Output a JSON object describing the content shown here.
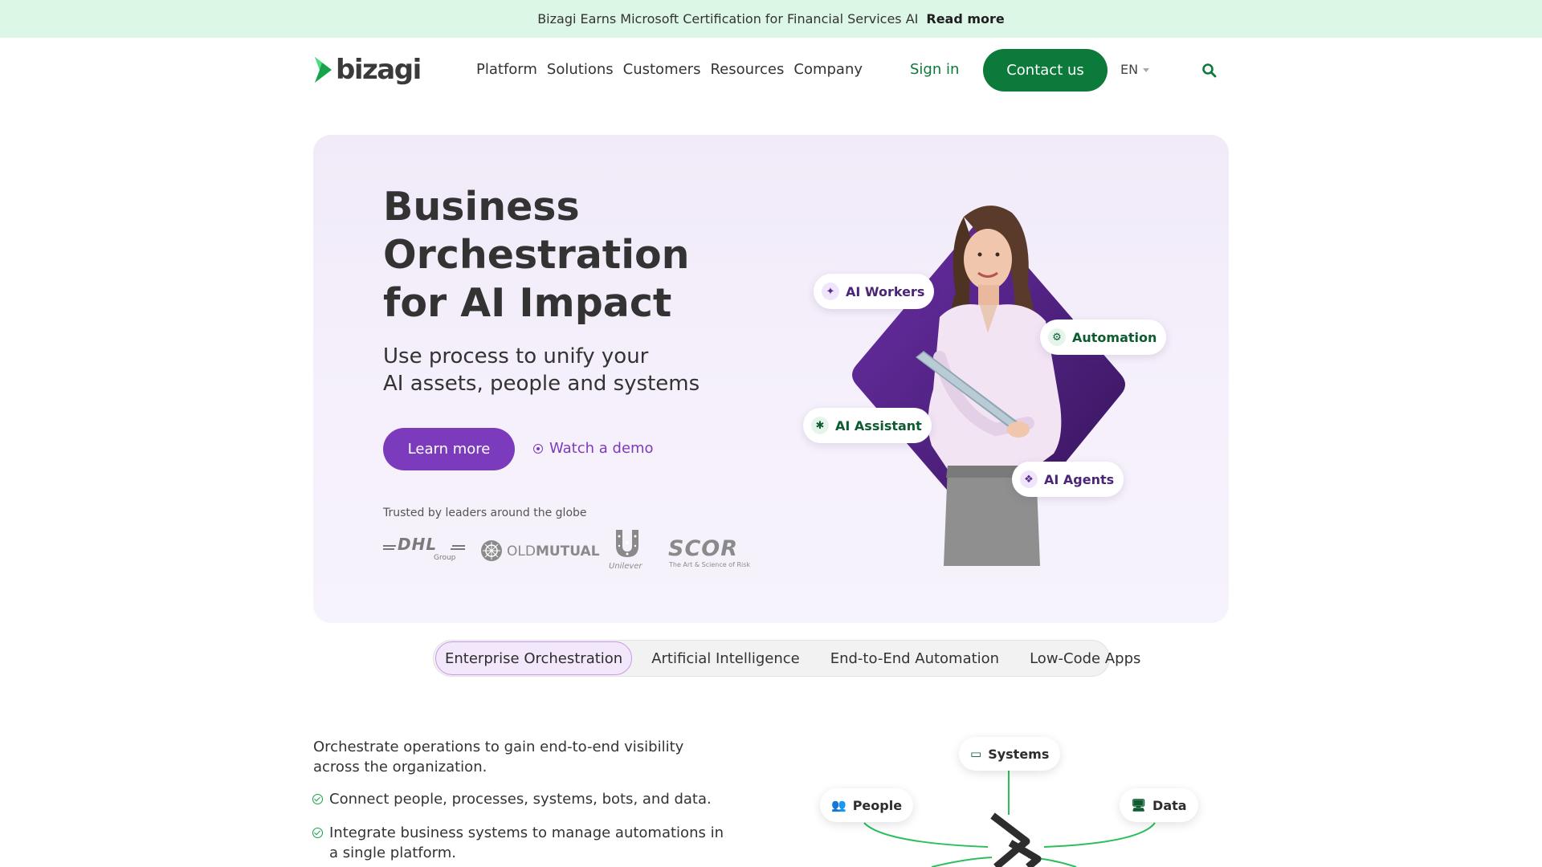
{
  "announcement": {
    "text": "Bizagi Earns Microsoft Certification for Financial Services AI",
    "link": "Read more"
  },
  "header": {
    "logo_text": "bizagi",
    "nav": [
      "Platform",
      "Solutions",
      "Customers",
      "Resources",
      "Company"
    ],
    "sign_in": "Sign in",
    "contact": "Contact us",
    "language": "EN"
  },
  "hero": {
    "title_lines": [
      "Business",
      "Orchestration",
      "for AI Impact"
    ],
    "subtitle_lines": [
      "Use process to unify your",
      "AI assets, people and systems"
    ],
    "primary_cta": "Learn more",
    "secondary_cta": "Watch a demo",
    "trusted_label": "Trusted by leaders around the globe",
    "customer_logos": {
      "dhl": {
        "name": "DHL",
        "sub": "Group"
      },
      "oldmutual": {
        "name_light": "OLD",
        "name_bold": "MUTUAL"
      },
      "unilever": {
        "name": "Unilever"
      },
      "scor": {
        "name": "SCOR",
        "tagline": "The Art & Science of Risk"
      }
    },
    "chips": {
      "ai_workers": "AI Workers",
      "automation": "Automation",
      "ai_assistant": "AI Assistant",
      "ai_agents": "AI Agents"
    }
  },
  "tabs": [
    "Enterprise Orchestration",
    "Artificial Intelligence",
    "End-to-End Automation",
    "Low-Code Apps"
  ],
  "active_tab": "Enterprise Orchestration",
  "content": {
    "description": "Orchestrate operations to gain end-to-end visibility across the organization.",
    "bullets": [
      "Connect people, processes, systems, bots, and data.",
      "Integrate business systems to manage automations in a single platform."
    ]
  },
  "diagram": {
    "systems": "Systems",
    "people": "People",
    "data": "Data"
  },
  "colors": {
    "brand_green": "#0b7a3a",
    "brand_purple": "#7c3bbd",
    "announcement_bg": "#ddf7e6",
    "hero_bg": "#f3eefa"
  }
}
